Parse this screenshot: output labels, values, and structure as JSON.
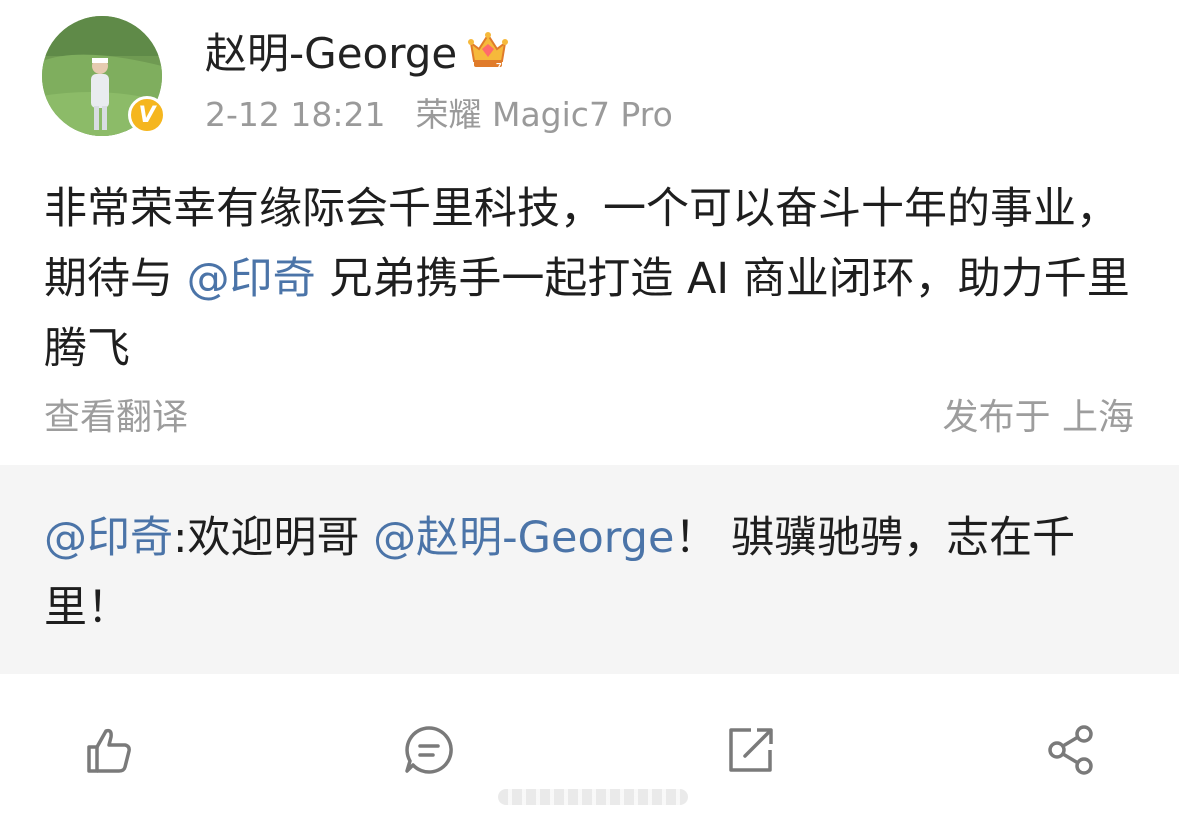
{
  "author": {
    "name": "赵明-George",
    "avatar_icon": "user-avatar-photo",
    "verified_icon": "verified-v-badge",
    "verified_letter": "V",
    "verified_color": "#f5b61e",
    "membership_icon": "crown-icon"
  },
  "meta": {
    "time": "2-12 18:21",
    "source": "荣耀 Magic7 Pro"
  },
  "post": {
    "text_1": "非常荣幸有缘际会千里科技，一个可以奋斗十年的事业，期待与 ",
    "mention": "@印奇",
    "text_2": " 兄弟携手一起打造 AI 商业闭环，助力千里腾飞"
  },
  "translate_label": "查看翻译",
  "location": "发布于 上海",
  "comment": {
    "author_mention": "@印奇",
    "text_1": ":欢迎明哥 ",
    "mention": "@赵明-George",
    "text_2": "！ 骐骥驰骋，志在千里！"
  },
  "actions": {
    "like_icon": "like-icon",
    "comment_icon": "comment-icon",
    "repost_icon": "repost-icon",
    "share_icon": "share-icon"
  },
  "colors": {
    "mention": "#4b74a8",
    "meta": "#9a9a9a",
    "comment_bg": "#f5f5f5"
  }
}
